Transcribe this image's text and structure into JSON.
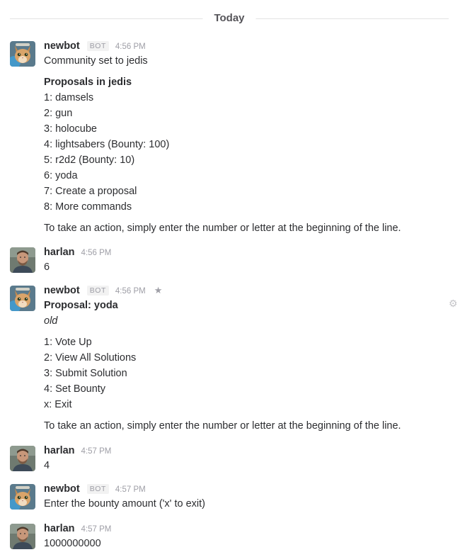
{
  "divider": {
    "label": "Today"
  },
  "messages": [
    {
      "author": "newbot",
      "badge": "BOT",
      "time": "4:56 PM",
      "first_line": "Community set to jedis",
      "list_title": "Proposals in jedis",
      "items": [
        "1: damsels",
        "2: gun",
        "3: holocube",
        "4: lightsabers (Bounty: 100)",
        "5: r2d2 (Bounty: 10)",
        "6: yoda",
        "7: Create a proposal",
        "8: More commands"
      ],
      "footer": "To take an action, simply enter the number or letter at the beginning of the line."
    },
    {
      "author": "harlan",
      "time": "4:56 PM",
      "text": "6"
    },
    {
      "author": "newbot",
      "badge": "BOT",
      "time": "4:56 PM",
      "title": "Proposal: yoda",
      "subtitle": "old",
      "items": [
        "1: Vote Up",
        "2: View All Solutions",
        "3: Submit Solution",
        "4: Set Bounty",
        "x: Exit"
      ],
      "footer": "To take an action, simply enter the number or letter at the beginning of the line."
    },
    {
      "author": "harlan",
      "time": "4:57 PM",
      "text": "4"
    },
    {
      "author": "newbot",
      "badge": "BOT",
      "time": "4:57 PM",
      "text": "Enter the bounty amount ('x' to exit)"
    },
    {
      "author": "harlan",
      "time": "4:57 PM",
      "text": "1000000000"
    }
  ],
  "icons": {
    "star": "star-icon",
    "gear": "gear-icon"
  }
}
